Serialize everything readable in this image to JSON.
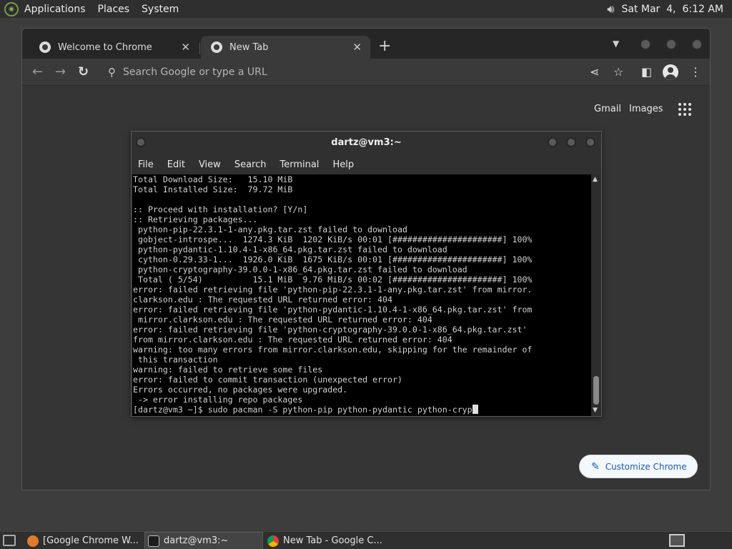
{
  "top_panel": {
    "menus": [
      "Applications",
      "Places",
      "System"
    ],
    "clock": "Sat Mar  4,  6:12 AM"
  },
  "chrome": {
    "tabs": [
      {
        "title": "Welcome to Chrome",
        "active": false
      },
      {
        "title": "New Tab",
        "active": true
      }
    ],
    "omnibox_placeholder": "Search Google or type a URL",
    "ntp_links": [
      "Gmail",
      "Images"
    ],
    "customize_label": "Customize Chrome"
  },
  "terminal": {
    "title": "dartz@vm3:~",
    "menus": [
      "File",
      "Edit",
      "View",
      "Search",
      "Terminal",
      "Help"
    ],
    "lines": [
      "Total Download Size:   15.10 MiB",
      "Total Installed Size:  79.72 MiB",
      "",
      ":: Proceed with installation? [Y/n]",
      ":: Retrieving packages...",
      " python-pip-22.3.1-1-any.pkg.tar.zst failed to download",
      " gobject-introspe...  1274.3 KiB  1202 KiB/s 00:01 [######################] 100%",
      " python-pydantic-1.10.4-1-x86_64.pkg.tar.zst failed to download",
      " cython-0.29.33-1...  1926.0 KiB  1675 KiB/s 00:01 [######################] 100%",
      " python-cryptography-39.0.0-1-x86_64.pkg.tar.zst failed to download",
      " Total ( 5/54)          15.1 MiB  9.76 MiB/s 00:02 [######################] 100%",
      "error: failed retrieving file 'python-pip-22.3.1-1-any.pkg.tar.zst' from mirror.",
      "clarkson.edu : The requested URL returned error: 404",
      "error: failed retrieving file 'python-pydantic-1.10.4-1-x86_64.pkg.tar.zst' from",
      " mirror.clarkson.edu : The requested URL returned error: 404",
      "error: failed retrieving file 'python-cryptography-39.0.0-1-x86_64.pkg.tar.zst'",
      "from mirror.clarkson.edu : The requested URL returned error: 404",
      "warning: too many errors from mirror.clarkson.edu, skipping for the remainder of",
      " this transaction",
      "warning: failed to retrieve some files",
      "error: failed to commit transaction (unexpected error)",
      "Errors occurred, no packages were upgraded.",
      " -> error installing repo packages"
    ],
    "prompt": "[dartz@vm3 ~]$ sudo pacman -S python-pip python-pydantic python-cryp"
  },
  "taskbar": {
    "tasks": [
      {
        "label": "[Google Chrome W...",
        "active": false
      },
      {
        "label": "dartz@vm3:~",
        "active": true
      },
      {
        "label": "New Tab - Google C...",
        "active": false
      }
    ]
  }
}
